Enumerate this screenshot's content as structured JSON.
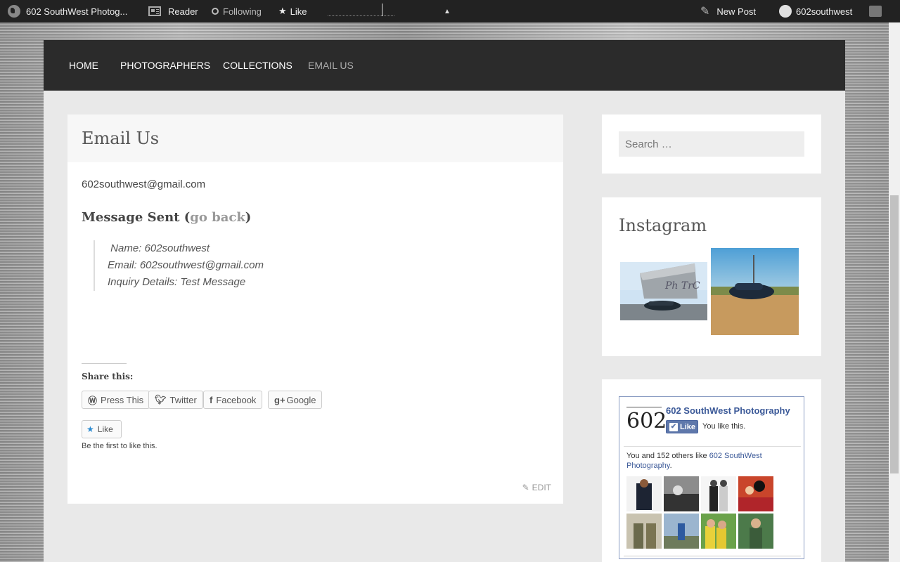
{
  "adminbar": {
    "site_name": "602 SouthWest Photog...",
    "reader": "Reader",
    "following": "Following",
    "like": "Like",
    "new_post": "New Post",
    "username": "602southwest"
  },
  "nav": {
    "items": [
      {
        "label": "HOME"
      },
      {
        "label": "PHOTOGRAPHERS"
      },
      {
        "label": "COLLECTIONS"
      },
      {
        "label": "EMAIL US"
      }
    ]
  },
  "article": {
    "title": "Email Us",
    "email": "602southwest@gmail.com",
    "message_sent_prefix": "Message Sent (",
    "go_back": "go back",
    "message_sent_suffix": ")",
    "quote_lines": [
      " Name: 602southwest",
      "Email: 602southwest@gmail.com",
      "Inquiry Details: Test Message"
    ],
    "share_title": "Share this:",
    "share_buttons": [
      {
        "label": "Press This",
        "icon": "wordpress-icon"
      },
      {
        "label": "Twitter",
        "icon": "twitter-icon"
      },
      {
        "label": "Facebook",
        "icon": "facebook-icon"
      },
      {
        "label": "Google",
        "icon": "google-plus-icon"
      }
    ],
    "like_label": "Like",
    "like_note": "Be the first to like this.",
    "edit_label": "EDIT"
  },
  "sidebar": {
    "search_placeholder": "Search …",
    "instagram_title": "Instagram",
    "facebook": {
      "page_name": "602 SouthWest Photography",
      "logo_text": "602",
      "like_button": "Like",
      "you_like": "You like this.",
      "count_text": "You and 152 others like ",
      "count_link": "602 SouthWest Photography",
      "count_end": "."
    }
  },
  "colors": {
    "adminbar_bg": "#222222",
    "nav_bg": "#2b2b2b",
    "facebook_blue": "#3b5998",
    "link_gray": "#999999"
  }
}
